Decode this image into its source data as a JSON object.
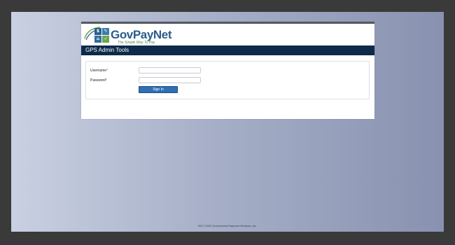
{
  "header": {
    "logo_cells": [
      "$",
      "✎",
      "⌂",
      "✓"
    ],
    "brand": "GovPayNet",
    "tagline": "The Simple Way To Pay"
  },
  "nav": {
    "title": "GPS Admin Tools"
  },
  "form": {
    "username_label": "Username",
    "password_label": "Password",
    "required_mark": "*",
    "username_value": "",
    "password_value": "",
    "signin_label": "Sign In"
  },
  "footer": {
    "text": "2017-2022 Government Payment Services, Inc."
  },
  "colors": {
    "brand_blue": "#2b5c8a",
    "nav_bar": "#0e2a4a",
    "button": "#2f6fb3",
    "required": "#c0392b"
  }
}
